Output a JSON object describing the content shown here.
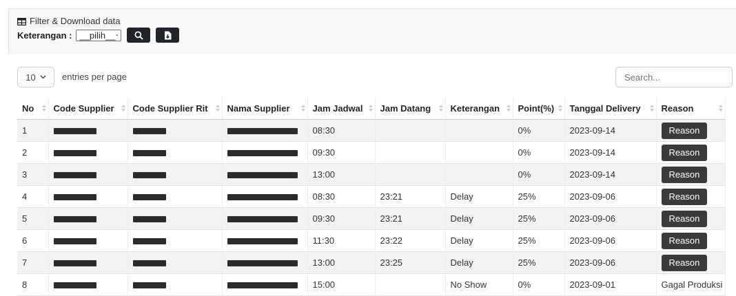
{
  "filter": {
    "title": "Filter & Download data",
    "keterangan_label": "Keterangan :",
    "keterangan_value": "__pilih__",
    "search_icon": "search-icon",
    "download_icon": "file-download-icon"
  },
  "length": {
    "value": "10",
    "suffix": "entries per page"
  },
  "search": {
    "placeholder": "Search..."
  },
  "columns": [
    "No",
    "Code Supplier",
    "Code Supplier Rit",
    "Nama Supplier",
    "Jam Jadwal",
    "Jam Datang",
    "Keterangan",
    "Point(%)",
    "Tanggal Delivery",
    "Reason"
  ],
  "rows": [
    {
      "no": "1",
      "jam_jadwal": "08:30",
      "jam_datang": "",
      "keterangan": "",
      "point": "0%",
      "tanggal": "2023-09-14",
      "reason": "Reason"
    },
    {
      "no": "2",
      "jam_jadwal": "09:30",
      "jam_datang": "",
      "keterangan": "",
      "point": "0%",
      "tanggal": "2023-09-14",
      "reason": "Reason"
    },
    {
      "no": "3",
      "jam_jadwal": "13:00",
      "jam_datang": "",
      "keterangan": "",
      "point": "0%",
      "tanggal": "2023-09-14",
      "reason": "Reason"
    },
    {
      "no": "4",
      "jam_jadwal": "08:30",
      "jam_datang": "23:21",
      "keterangan": "Delay",
      "point": "25%",
      "tanggal": "2023-09-06",
      "reason": "Reason"
    },
    {
      "no": "5",
      "jam_jadwal": "09:30",
      "jam_datang": "23:21",
      "keterangan": "Delay",
      "point": "25%",
      "tanggal": "2023-09-06",
      "reason": "Reason"
    },
    {
      "no": "6",
      "jam_jadwal": "11:30",
      "jam_datang": "23:22",
      "keterangan": "Delay",
      "point": "25%",
      "tanggal": "2023-09-06",
      "reason": "Reason"
    },
    {
      "no": "7",
      "jam_jadwal": "13:00",
      "jam_datang": "23:25",
      "keterangan": "Delay",
      "point": "25%",
      "tanggal": "2023-09-06",
      "reason": "Reason"
    },
    {
      "no": "8",
      "jam_jadwal": "15:00",
      "jam_datang": "",
      "keterangan": "No Show",
      "point": "0%",
      "tanggal": "2023-09-01",
      "reason": "Gagal Produksi"
    }
  ],
  "colors": {
    "button_dark": "#212529",
    "reason_button": "#3a3a3a",
    "redaction": "#2b2b2b"
  }
}
